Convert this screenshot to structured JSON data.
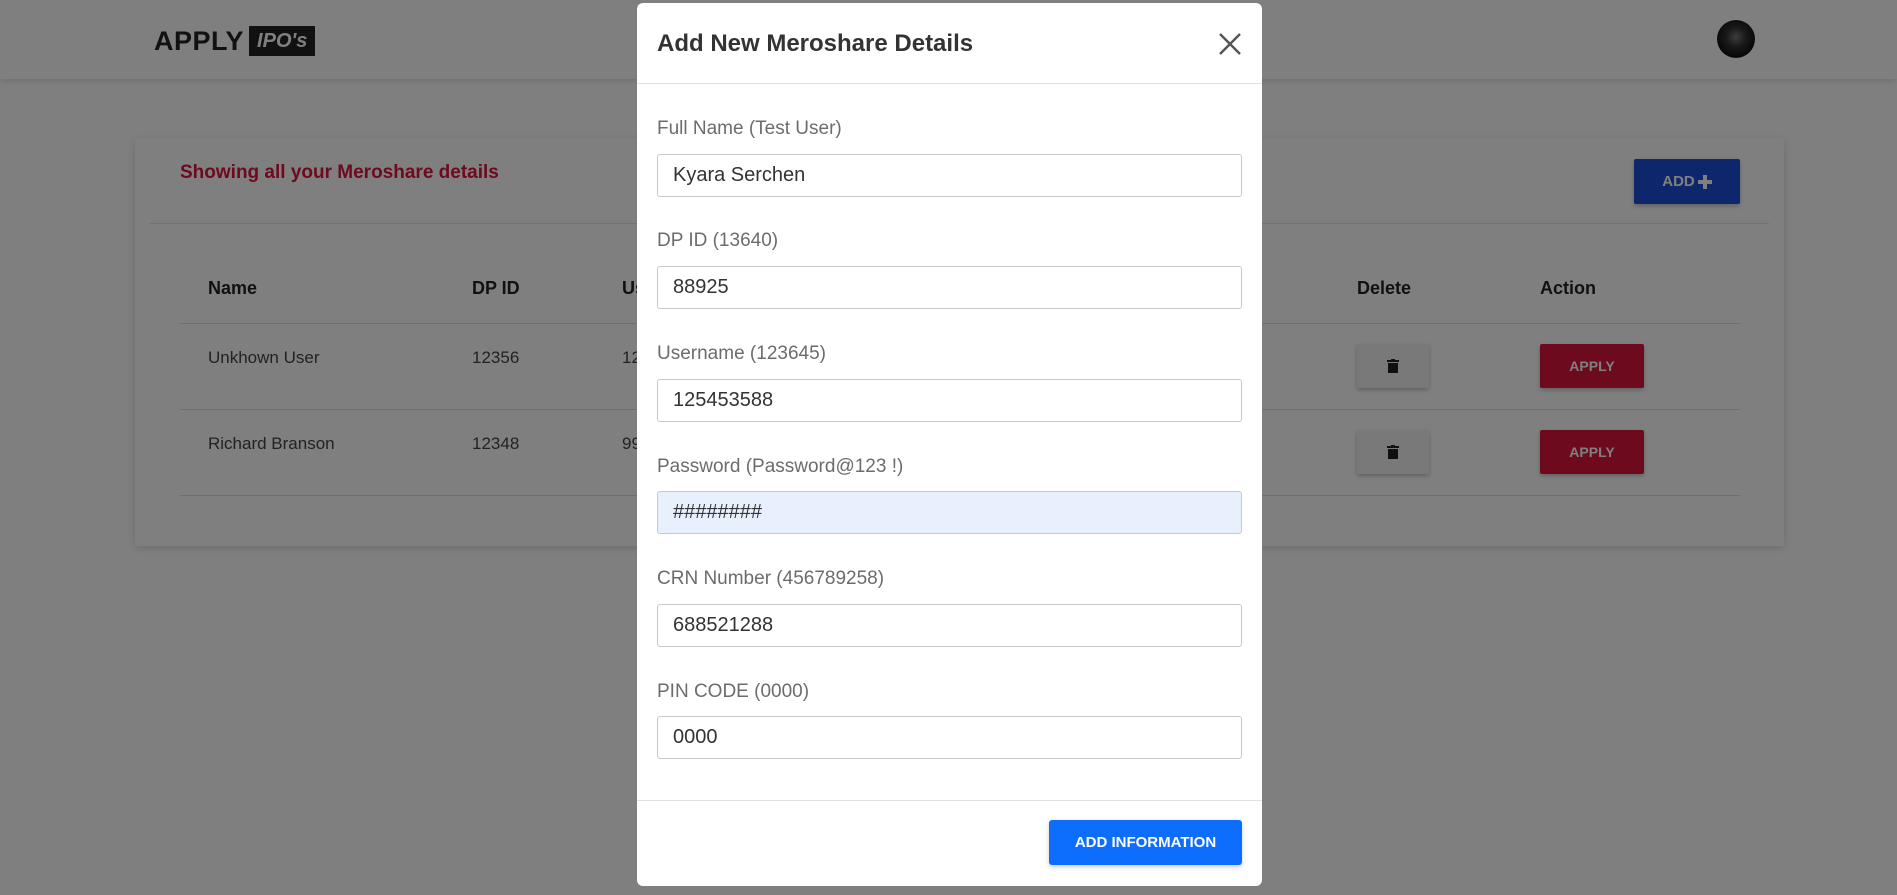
{
  "navbar": {
    "logo_text": "APPLY",
    "logo_badge": "IPO's"
  },
  "card": {
    "title": "Showing all your Meroshare details",
    "add_button": "ADD",
    "columns": [
      "Name",
      "DP ID",
      "Us",
      "Delete",
      "Action"
    ],
    "rows": [
      {
        "name": "Unkhown User",
        "dp_id": "12356",
        "username_partial": "12"
      },
      {
        "name": "Richard Branson",
        "dp_id": "12348",
        "username_partial": "99"
      }
    ],
    "apply_label": "APPLY"
  },
  "modal": {
    "title": "Add New Meroshare Details",
    "fields": [
      {
        "label": "Full Name (Test User)",
        "value": "Kyara Serchen"
      },
      {
        "label": "DP ID (13640)",
        "value": "88925"
      },
      {
        "label": "Username (123645)",
        "value": "125453588"
      },
      {
        "label": "Password (Password@123 !)",
        "value": "########"
      },
      {
        "label": "CRN Number (456789258)",
        "value": "688521288"
      },
      {
        "label": "PIN CODE (0000)",
        "value": "0000"
      }
    ],
    "submit_label": "ADD INFORMATION"
  },
  "colors": {
    "accent_red": "#dc143c",
    "accent_blue": "#0d6efd",
    "autofill_bg": "#e8f0fe"
  },
  "icons": {
    "close": "close-icon",
    "delete": "trash-icon",
    "plus": "plus-icon",
    "avatar": "avatar"
  }
}
